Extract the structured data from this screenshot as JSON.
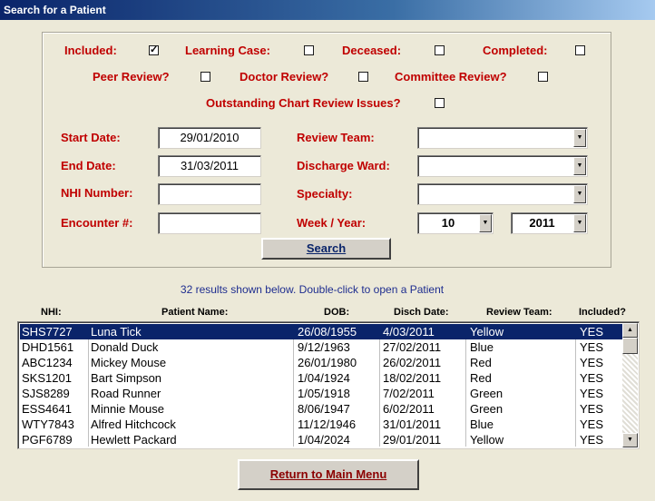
{
  "window": {
    "title": "Search for a Patient"
  },
  "filters": {
    "included": {
      "label": "Included:",
      "checked": true
    },
    "learning_case": {
      "label": "Learning Case:",
      "checked": false
    },
    "deceased": {
      "label": "Deceased:",
      "checked": false
    },
    "completed": {
      "label": "Completed:",
      "checked": false
    },
    "peer_review": {
      "label": "Peer Review?",
      "checked": false
    },
    "doctor_review": {
      "label": "Doctor Review?",
      "checked": false
    },
    "committee_review": {
      "label": "Committee Review?",
      "checked": false
    },
    "outstanding": {
      "label": "Outstanding Chart Review Issues?",
      "checked": false
    }
  },
  "fields": {
    "start_date": {
      "label": "Start Date:",
      "value": "29/01/2010"
    },
    "end_date": {
      "label": "End Date:",
      "value": "31/03/2011"
    },
    "nhi_number": {
      "label": "NHI Number:",
      "value": ""
    },
    "encounter": {
      "label": "Encounter #:",
      "value": ""
    },
    "review_team": {
      "label": "Review Team:",
      "value": ""
    },
    "discharge_ward": {
      "label": "Discharge Ward:",
      "value": ""
    },
    "specialty": {
      "label": "Specialty:",
      "value": ""
    },
    "week_year": {
      "label": "Week / Year:",
      "week": "10",
      "year": "2011"
    }
  },
  "search_button": {
    "label": "Search"
  },
  "results_info": "32  results shown below.   Double-click to open a Patient",
  "columns": [
    "NHI:",
    "Patient Name:",
    "DOB:",
    "Disch Date:",
    "Review Team:",
    "Included?"
  ],
  "rows": [
    {
      "nhi": "SHS7727",
      "name": "Luna Tick",
      "dob": "26/08/1955",
      "disch": "4/03/2011",
      "team": "Yellow",
      "included": "YES",
      "selected": true
    },
    {
      "nhi": "DHD1561",
      "name": "Donald Duck",
      "dob": "9/12/1963",
      "disch": "27/02/2011",
      "team": "Blue",
      "included": "YES"
    },
    {
      "nhi": "ABC1234",
      "name": "Mickey Mouse",
      "dob": "26/01/1980",
      "disch": "26/02/2011",
      "team": "Red",
      "included": "YES"
    },
    {
      "nhi": "SKS1201",
      "name": "Bart Simpson",
      "dob": "1/04/1924",
      "disch": "18/02/2011",
      "team": "Red",
      "included": "YES"
    },
    {
      "nhi": "SJS8289",
      "name": "Road Runner",
      "dob": "1/05/1918",
      "disch": "7/02/2011",
      "team": "Green",
      "included": "YES"
    },
    {
      "nhi": "ESS4641",
      "name": "Minnie Mouse",
      "dob": "8/06/1947",
      "disch": "6/02/2011",
      "team": "Green",
      "included": "YES"
    },
    {
      "nhi": "WTY7843",
      "name": "Alfred Hitchcock",
      "dob": "11/12/1946",
      "disch": "31/01/2011",
      "team": "Blue",
      "included": "YES"
    },
    {
      "nhi": "PGF6789",
      "name": "Hewlett Packard",
      "dob": "1/04/2024",
      "disch": "29/01/2011",
      "team": "Yellow",
      "included": "YES"
    }
  ],
  "return_button": {
    "label": "Return to Main Menu"
  },
  "icons": {
    "scroll_up": "up-arrow",
    "scroll_down": "down-arrow",
    "dropdown": "down-arrow",
    "checkmark": "check"
  }
}
